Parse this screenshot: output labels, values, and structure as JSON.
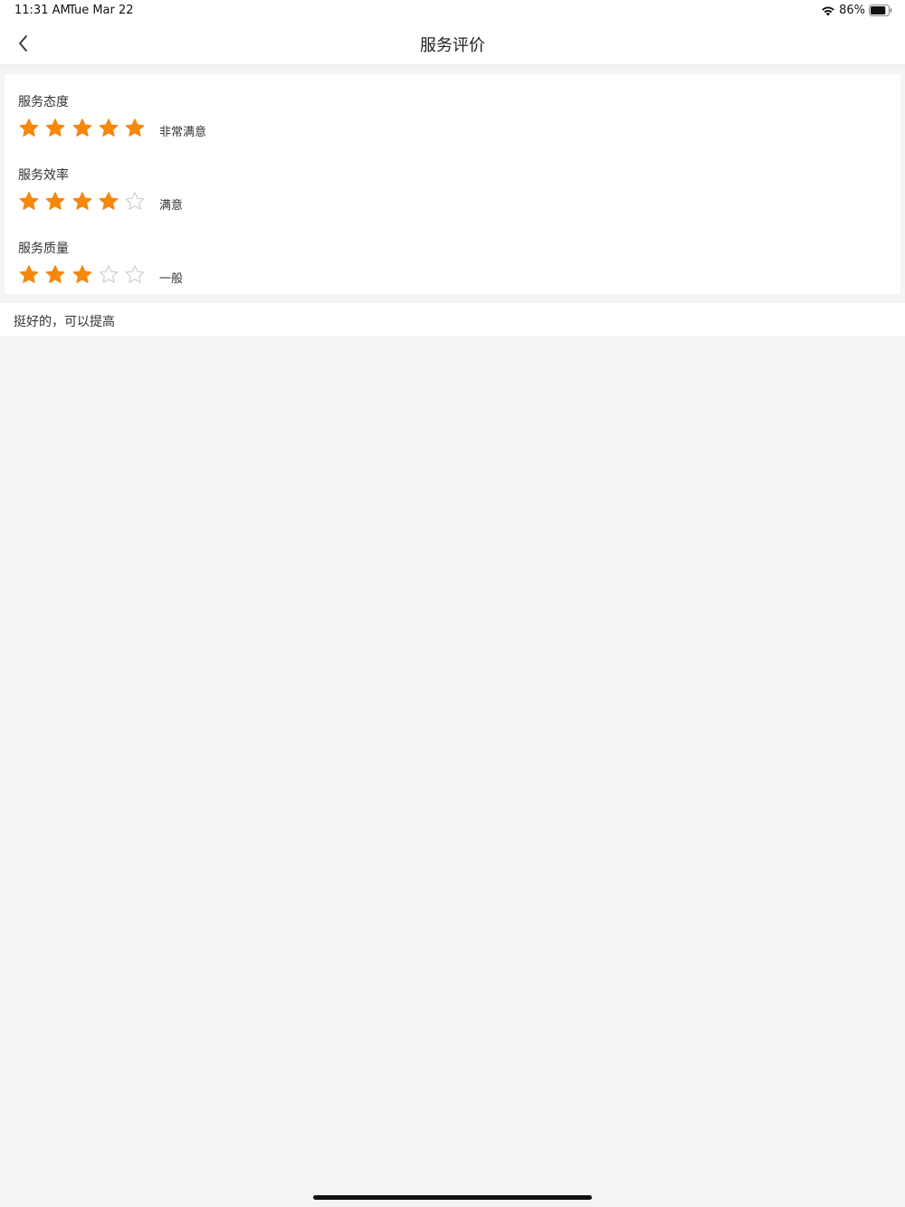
{
  "status_bar": {
    "time": "11:31 AM",
    "date": "Tue Mar 22",
    "battery": "86%",
    "battery_level": 0.86
  },
  "nav": {
    "title": "服务评价",
    "back_icon": "chevron-left-icon"
  },
  "ratings": [
    {
      "label": "服务态度",
      "stars": 5,
      "max": 5,
      "text": "非常满意"
    },
    {
      "label": "服务效率",
      "stars": 4,
      "max": 5,
      "text": "满意"
    },
    {
      "label": "服务质量",
      "stars": 3,
      "max": 5,
      "text": "一般"
    }
  ],
  "comment": "挺好的，可以提高",
  "colors": {
    "star_filled": "#f5870a",
    "star_empty": "#cfcfcf",
    "background": "#f4f4f4"
  }
}
